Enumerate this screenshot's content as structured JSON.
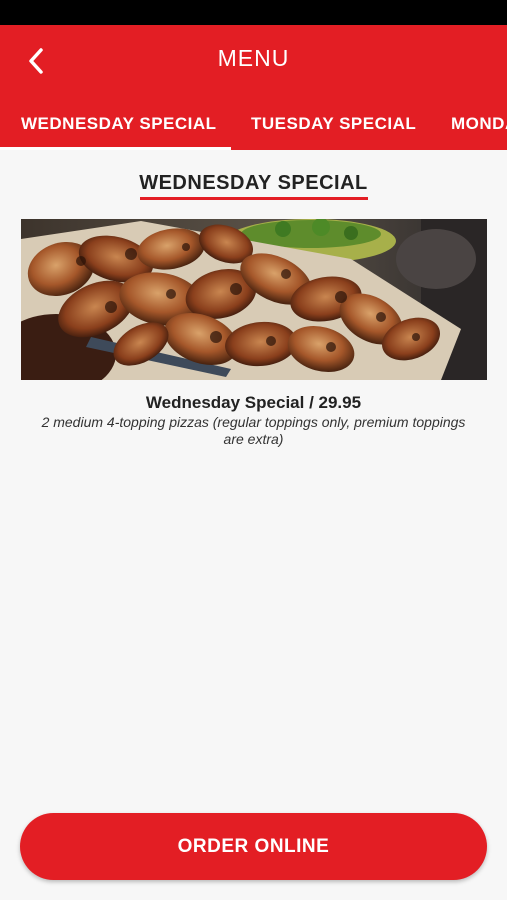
{
  "header": {
    "title": "MENU",
    "back_icon": "chevron-left-icon"
  },
  "tabs": [
    {
      "label": "WEDNESDAY SPECIAL",
      "active": true
    },
    {
      "label": "TUESDAY SPECIAL",
      "active": false
    },
    {
      "label": "MONDA",
      "active": false
    }
  ],
  "section": {
    "title": "WEDNESDAY SPECIAL"
  },
  "item": {
    "image": "grilled-chicken-wings-photo",
    "title": "Wednesday Special / 29.95",
    "description": "2 medium 4-topping pizzas (regular toppings only, premium toppings are extra)"
  },
  "order_button": {
    "label": "ORDER ONLINE"
  },
  "colors": {
    "brand_red": "#e31e24",
    "background": "#f7f7f7",
    "text_dark": "#222222"
  }
}
